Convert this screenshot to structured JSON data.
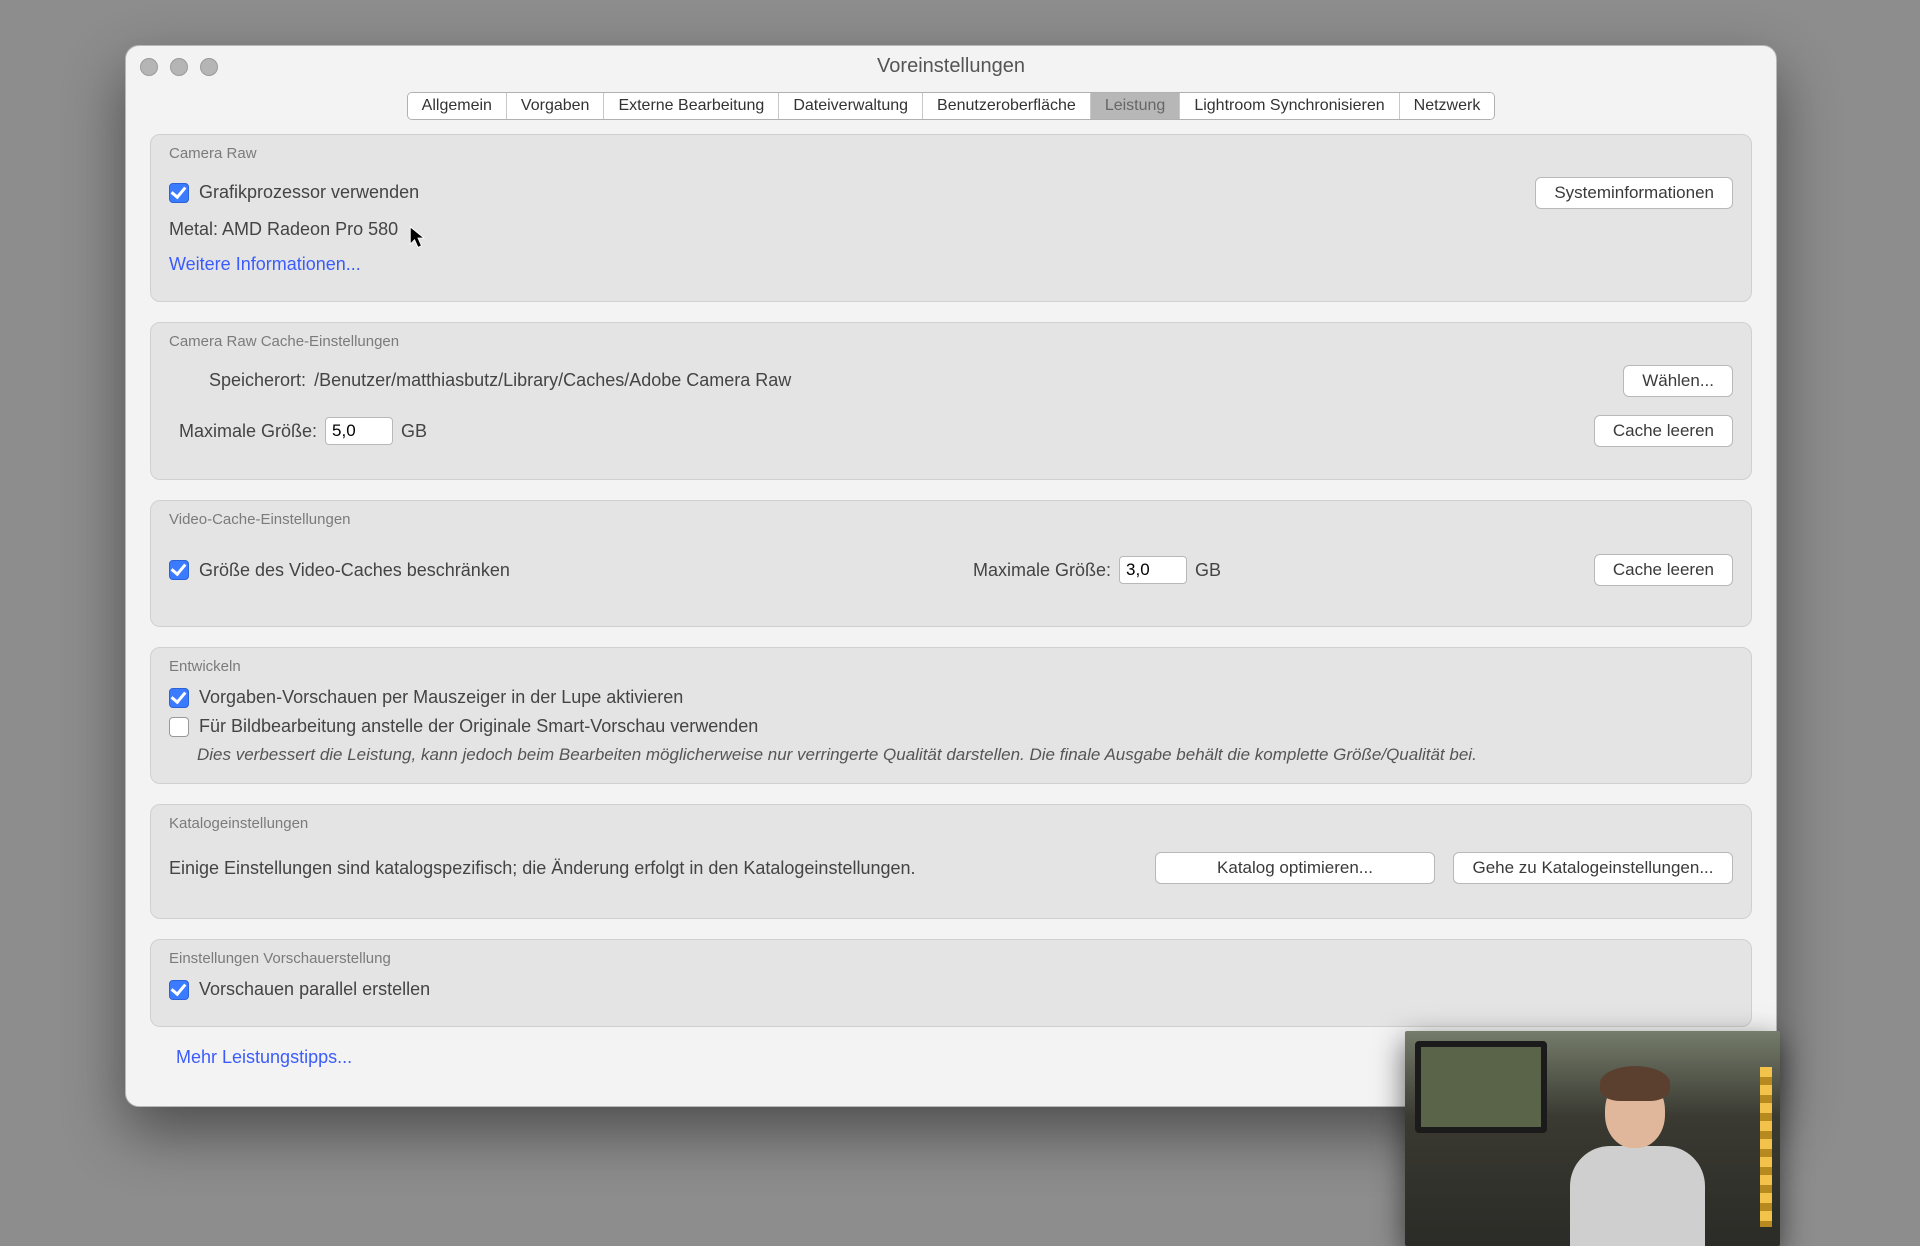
{
  "window": {
    "title": "Voreinstellungen"
  },
  "tabs": [
    {
      "label": "Allgemein"
    },
    {
      "label": "Vorgaben"
    },
    {
      "label": "Externe Bearbeitung"
    },
    {
      "label": "Dateiverwaltung"
    },
    {
      "label": "Benutzeroberfläche"
    },
    {
      "label": "Leistung",
      "active": true
    },
    {
      "label": "Lightroom Synchronisieren"
    },
    {
      "label": "Netzwerk"
    }
  ],
  "cameraRaw": {
    "title": "Camera Raw",
    "useGpuLabel": "Grafikprozessor verwenden",
    "gpuInfo": "Metal: AMD Radeon Pro 580",
    "moreInfo": "Weitere Informationen...",
    "sysInfoBtn": "Systeminformationen"
  },
  "crCache": {
    "title": "Camera Raw Cache-Einstellungen",
    "locLabel": "Speicherort:",
    "locValue": "/Benutzer/matthiasbutz/Library/Caches/Adobe Camera Raw",
    "chooseBtn": "Wählen...",
    "maxLabel": "Maximale Größe:",
    "maxValue": "5,0",
    "unit": "GB",
    "purgeBtn": "Cache leeren"
  },
  "videoCache": {
    "title": "Video-Cache-Einstellungen",
    "limitLabel": "Größe des Video-Caches beschränken",
    "maxLabel": "Maximale Größe:",
    "maxValue": "3,0",
    "unit": "GB",
    "purgeBtn": "Cache leeren"
  },
  "develop": {
    "title": "Entwickeln",
    "presetHoverLabel": "Vorgaben-Vorschauen per Mauszeiger in der Lupe aktivieren",
    "smartPreviewLabel": "Für Bildbearbeitung anstelle der Originale Smart-Vorschau verwenden",
    "note": "Dies verbessert die Leistung, kann jedoch beim Bearbeiten möglicherweise nur verringerte Qualität darstellen. Die finale Ausgabe behält die komplette Größe/Qualität bei."
  },
  "catalog": {
    "title": "Katalogeinstellungen",
    "text": "Einige Einstellungen sind katalogspezifisch; die Änderung erfolgt in den Katalogeinstellungen.",
    "optimizeBtn": "Katalog optimieren...",
    "gotoBtn": "Gehe zu Katalogeinstellungen..."
  },
  "previewGen": {
    "title": "Einstellungen Vorschauerstellung",
    "parallelLabel": "Vorschauen parallel erstellen"
  },
  "footerLink": "Mehr Leistungstipps..."
}
